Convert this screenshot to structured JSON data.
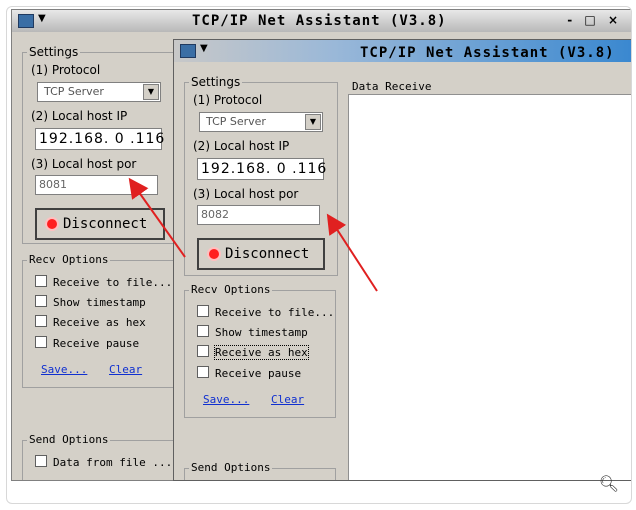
{
  "app": {
    "title": "TCP/IP Net Assistant (V3.8)",
    "window_controls": "- □ ×"
  },
  "back_window": {
    "settings_label": "Settings",
    "protocol_label": "(1) Protocol",
    "protocol_value": "TCP Server",
    "local_ip_label": "(2) Local host IP",
    "local_ip_value": "192.168. 0 .116",
    "local_port_label": "(3) Local host por",
    "local_port_value": "8081",
    "disconnect_label": "Disconnect",
    "recv_options_label": "Recv Options",
    "recv_to_file": "Receive to file...",
    "show_timestamp": "Show timestamp",
    "receive_as_hex": "Receive as hex",
    "receive_pause": "Receive pause",
    "save_link": "Save...",
    "clear_link": "Clear",
    "send_options_label": "Send Options",
    "data_from_file": "Data from file ..."
  },
  "front_window": {
    "settings_label": "Settings",
    "protocol_label": "(1) Protocol",
    "protocol_value": "TCP Server",
    "local_ip_label": "(2) Local host IP",
    "local_ip_value": "192.168. 0 .116",
    "local_port_label": "(3) Local host por",
    "local_port_value": "8082",
    "disconnect_label": "Disconnect",
    "data_receive_label": "Data Receive",
    "recv_options_label": "Recv Options",
    "recv_to_file": "Receive to file...",
    "show_timestamp": "Show timestamp",
    "receive_as_hex": "Receive as hex",
    "receive_pause": "Receive pause",
    "save_link": "Save...",
    "clear_link": "Clear",
    "send_options_label": "Send Options"
  },
  "icons": {
    "zoom": "magnifier-plus-icon",
    "arrow_color": "#e02020"
  }
}
